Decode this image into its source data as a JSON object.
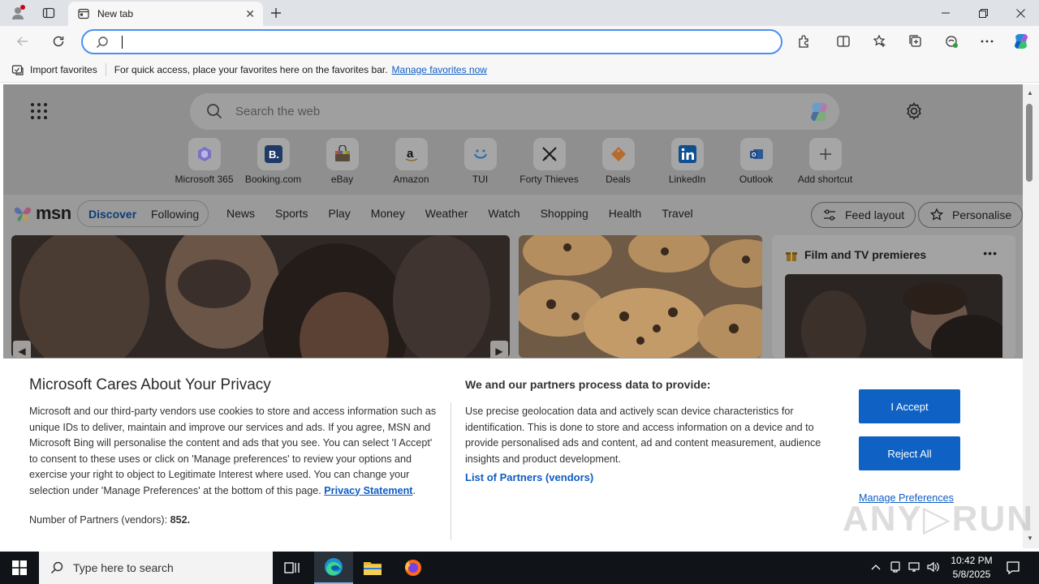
{
  "window": {
    "tab_title": "New tab"
  },
  "toolbar": {
    "address_value": ""
  },
  "favorites_bar": {
    "import_label": "Import favorites",
    "hint": "For quick access, place your favorites here on the favorites bar.",
    "manage_link": "Manage favorites now"
  },
  "ntp": {
    "search_placeholder": "Search the web",
    "shortcuts": [
      {
        "label": "Microsoft 365",
        "icon": "m365-icon",
        "color": "#7b6cf5"
      },
      {
        "label": "Booking.com",
        "icon": "booking-icon",
        "color": "#1b3f86"
      },
      {
        "label": "eBay",
        "icon": "ebay-icon",
        "color": "#e53238"
      },
      {
        "label": "Amazon",
        "icon": "amazon-icon",
        "color": "#111111"
      },
      {
        "label": "TUI",
        "icon": "tui-icon",
        "color": "#1a8ad6"
      },
      {
        "label": "Forty Thieves",
        "icon": "swords-icon",
        "color": "#1a1a1a"
      },
      {
        "label": "Deals",
        "icon": "deals-icon",
        "color": "#e07a1e"
      },
      {
        "label": "LinkedIn",
        "icon": "linkedin-icon",
        "color": "#0a66c2"
      },
      {
        "label": "Outlook",
        "icon": "outlook-icon",
        "color": "#0f6cbd"
      },
      {
        "label": "Add shortcut",
        "icon": "plus-icon",
        "color": "#3a3a3a"
      }
    ]
  },
  "msn": {
    "logo_text": "msn",
    "discover": "Discover",
    "following": "Following",
    "nav_links": [
      "News",
      "Sports",
      "Play",
      "Money",
      "Weather",
      "Watch",
      "Shopping",
      "Health",
      "Travel"
    ],
    "feed_layout": "Feed layout",
    "personalise": "Personalise",
    "film_title": "Film and TV premieres"
  },
  "privacy": {
    "title": "Microsoft Cares About Your Privacy",
    "body": "Microsoft and our third-party vendors use cookies to store and access information such as unique IDs to deliver, maintain and improve our services and ads. If you agree, MSN and Microsoft Bing will personalise the content and ads that you see. You can select 'I Accept' to consent to these uses or click on 'Manage preferences' to review your options and exercise your right to object to Legitimate Interest where used.  You can change your selection under 'Manage Preferences' at the bottom of this page.",
    "privacy_link": "Privacy Statement",
    "partners_label": "Number of Partners (vendors):",
    "partners_count": "852.",
    "subtitle": "We and our partners process data to provide:",
    "description": "Use precise geolocation data and actively scan device characteristics for identification. This is done to store and access information on a device and to provide personalised ads and content, ad and content measurement, audience insights and product development.",
    "vendors_link": "List of Partners (vendors)",
    "accept": "I Accept",
    "reject": "Reject All",
    "manage": "Manage Preferences"
  },
  "taskbar": {
    "search_placeholder": "Type here to search",
    "time": "10:42 PM",
    "date": "5/8/2025"
  },
  "colors": {
    "accent": "#0f62c4",
    "link": "#0f5cc4",
    "taskbar": "#101418"
  }
}
